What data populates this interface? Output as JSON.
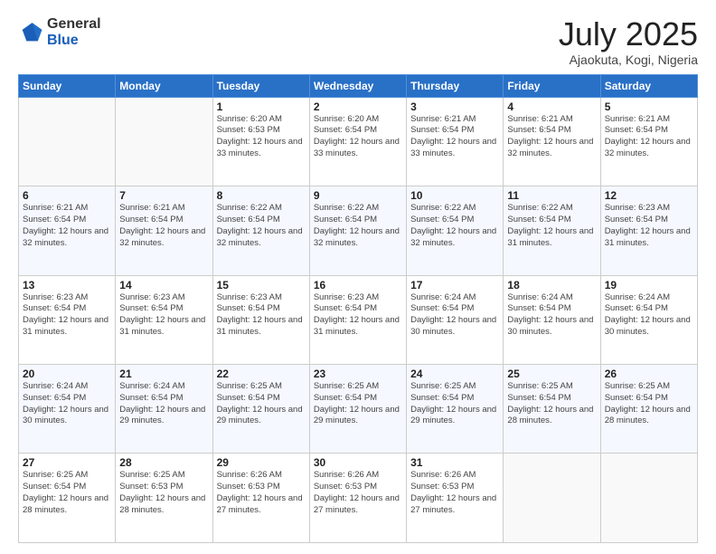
{
  "header": {
    "logo_general": "General",
    "logo_blue": "Blue",
    "month_title": "July 2025",
    "location": "Ajaokuta, Kogi, Nigeria"
  },
  "days_of_week": [
    "Sunday",
    "Monday",
    "Tuesday",
    "Wednesday",
    "Thursday",
    "Friday",
    "Saturday"
  ],
  "weeks": [
    [
      {
        "day": "",
        "info": ""
      },
      {
        "day": "",
        "info": ""
      },
      {
        "day": "1",
        "info": "Sunrise: 6:20 AM\nSunset: 6:53 PM\nDaylight: 12 hours and 33 minutes."
      },
      {
        "day": "2",
        "info": "Sunrise: 6:20 AM\nSunset: 6:54 PM\nDaylight: 12 hours and 33 minutes."
      },
      {
        "day": "3",
        "info": "Sunrise: 6:21 AM\nSunset: 6:54 PM\nDaylight: 12 hours and 33 minutes."
      },
      {
        "day": "4",
        "info": "Sunrise: 6:21 AM\nSunset: 6:54 PM\nDaylight: 12 hours and 32 minutes."
      },
      {
        "day": "5",
        "info": "Sunrise: 6:21 AM\nSunset: 6:54 PM\nDaylight: 12 hours and 32 minutes."
      }
    ],
    [
      {
        "day": "6",
        "info": "Sunrise: 6:21 AM\nSunset: 6:54 PM\nDaylight: 12 hours and 32 minutes."
      },
      {
        "day": "7",
        "info": "Sunrise: 6:21 AM\nSunset: 6:54 PM\nDaylight: 12 hours and 32 minutes."
      },
      {
        "day": "8",
        "info": "Sunrise: 6:22 AM\nSunset: 6:54 PM\nDaylight: 12 hours and 32 minutes."
      },
      {
        "day": "9",
        "info": "Sunrise: 6:22 AM\nSunset: 6:54 PM\nDaylight: 12 hours and 32 minutes."
      },
      {
        "day": "10",
        "info": "Sunrise: 6:22 AM\nSunset: 6:54 PM\nDaylight: 12 hours and 32 minutes."
      },
      {
        "day": "11",
        "info": "Sunrise: 6:22 AM\nSunset: 6:54 PM\nDaylight: 12 hours and 31 minutes."
      },
      {
        "day": "12",
        "info": "Sunrise: 6:23 AM\nSunset: 6:54 PM\nDaylight: 12 hours and 31 minutes."
      }
    ],
    [
      {
        "day": "13",
        "info": "Sunrise: 6:23 AM\nSunset: 6:54 PM\nDaylight: 12 hours and 31 minutes."
      },
      {
        "day": "14",
        "info": "Sunrise: 6:23 AM\nSunset: 6:54 PM\nDaylight: 12 hours and 31 minutes."
      },
      {
        "day": "15",
        "info": "Sunrise: 6:23 AM\nSunset: 6:54 PM\nDaylight: 12 hours and 31 minutes."
      },
      {
        "day": "16",
        "info": "Sunrise: 6:23 AM\nSunset: 6:54 PM\nDaylight: 12 hours and 31 minutes."
      },
      {
        "day": "17",
        "info": "Sunrise: 6:24 AM\nSunset: 6:54 PM\nDaylight: 12 hours and 30 minutes."
      },
      {
        "day": "18",
        "info": "Sunrise: 6:24 AM\nSunset: 6:54 PM\nDaylight: 12 hours and 30 minutes."
      },
      {
        "day": "19",
        "info": "Sunrise: 6:24 AM\nSunset: 6:54 PM\nDaylight: 12 hours and 30 minutes."
      }
    ],
    [
      {
        "day": "20",
        "info": "Sunrise: 6:24 AM\nSunset: 6:54 PM\nDaylight: 12 hours and 30 minutes."
      },
      {
        "day": "21",
        "info": "Sunrise: 6:24 AM\nSunset: 6:54 PM\nDaylight: 12 hours and 29 minutes."
      },
      {
        "day": "22",
        "info": "Sunrise: 6:25 AM\nSunset: 6:54 PM\nDaylight: 12 hours and 29 minutes."
      },
      {
        "day": "23",
        "info": "Sunrise: 6:25 AM\nSunset: 6:54 PM\nDaylight: 12 hours and 29 minutes."
      },
      {
        "day": "24",
        "info": "Sunrise: 6:25 AM\nSunset: 6:54 PM\nDaylight: 12 hours and 29 minutes."
      },
      {
        "day": "25",
        "info": "Sunrise: 6:25 AM\nSunset: 6:54 PM\nDaylight: 12 hours and 28 minutes."
      },
      {
        "day": "26",
        "info": "Sunrise: 6:25 AM\nSunset: 6:54 PM\nDaylight: 12 hours and 28 minutes."
      }
    ],
    [
      {
        "day": "27",
        "info": "Sunrise: 6:25 AM\nSunset: 6:54 PM\nDaylight: 12 hours and 28 minutes."
      },
      {
        "day": "28",
        "info": "Sunrise: 6:25 AM\nSunset: 6:53 PM\nDaylight: 12 hours and 28 minutes."
      },
      {
        "day": "29",
        "info": "Sunrise: 6:26 AM\nSunset: 6:53 PM\nDaylight: 12 hours and 27 minutes."
      },
      {
        "day": "30",
        "info": "Sunrise: 6:26 AM\nSunset: 6:53 PM\nDaylight: 12 hours and 27 minutes."
      },
      {
        "day": "31",
        "info": "Sunrise: 6:26 AM\nSunset: 6:53 PM\nDaylight: 12 hours and 27 minutes."
      },
      {
        "day": "",
        "info": ""
      },
      {
        "day": "",
        "info": ""
      }
    ]
  ]
}
